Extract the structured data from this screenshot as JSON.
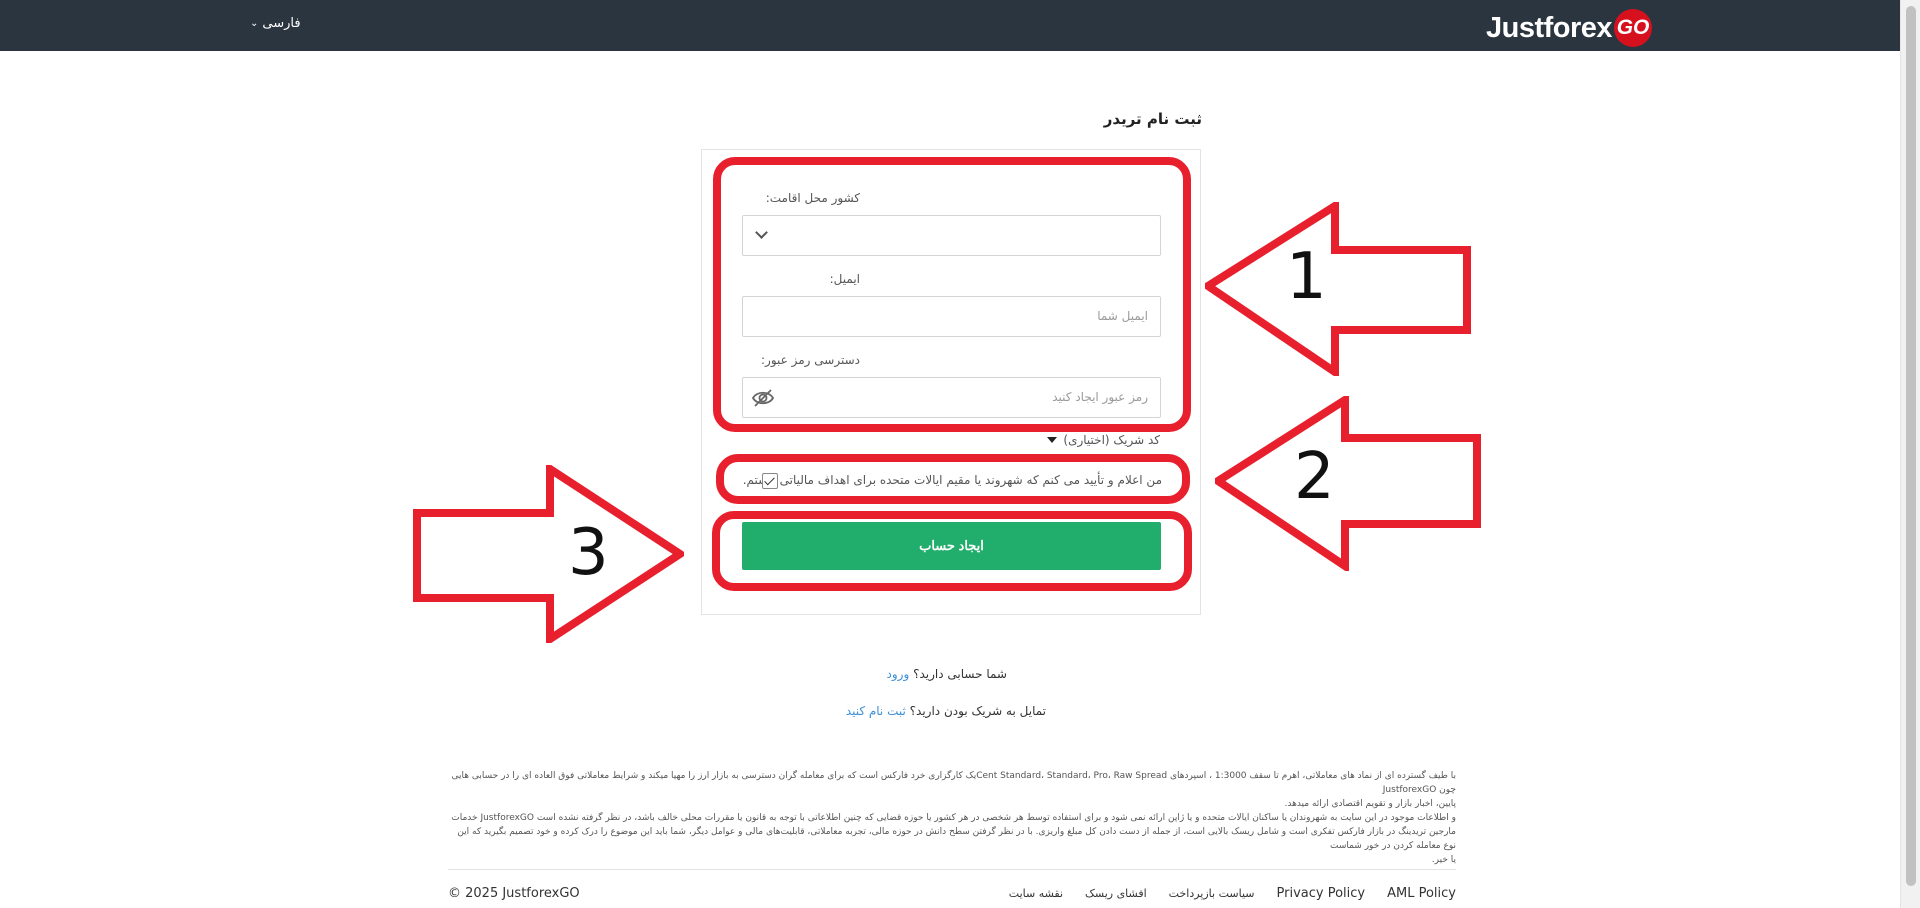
{
  "header": {
    "language": "فارسی",
    "logo_text": "Justforex",
    "logo_badge": "GO",
    "brand_color": "#2b3540",
    "logo_red": "#d7101e"
  },
  "page_title": "ثبت نام تریدر",
  "form": {
    "country_label": "کشور محل اقامت:",
    "country_value": "",
    "email_label": "ایمیل:",
    "email_placeholder": "ایمیل شما",
    "password_label": "دسترسی رمز عبور:",
    "password_placeholder": "رمز عبور ایجاد کنید",
    "partner_code_label": "کد شریک (اختیاری)",
    "declaration": "من اعلام و تأیید می کنم که شهروند یا مقیم ایالات متحده برای اهداف مالیاتی نیستم.",
    "declaration_checked": true,
    "submit_label": "ایجاد حساب",
    "submit_color": "#21ad6b"
  },
  "annotations": {
    "color": "#e8202e",
    "labels": [
      "1",
      "2",
      "3"
    ]
  },
  "links": {
    "have_account": "شما حسابی دارید؟",
    "login": "ورود",
    "partner_question": "تمایل به شریک بودن دارید؟",
    "partner_signup": "ثبت نام کنید"
  },
  "disclaimer": {
    "paragraph1_line1": "با طیف گسترده ای از نماد های معاملاتی، اهرم تا سقف 1:3000 ، اسپردهای Cent Standard، Standard، Pro، Raw Spreadیک کارگزاری خرد فارکس است که برای معامله گران دسترسی به بازار ارز را مهیا میکند و شرایط معاملاتی فوق العاده ای را در حسابی هایی چون JustforexGO",
    "paragraph1_line2": "پایین، اخبار بازار و تقویم اقتصادی ارائه میدهد.",
    "paragraph2_line1": "و اطلاعات موجود در این سایت به شهروندان یا ساکنان ایالات متحده و یا ژاپن ارائه نمی شود و برای استفاده توسط هر شخصی در هر کشور یا حوزه قضایی که چنین اطلاعاتی با توجه به قانون یا مقررات محلی خالف باشد، در نظر گرفته نشده است JustforexGO خدمات",
    "paragraph2_line2": "مارجین تریدینگ در بازار فارکس تفکری است و شامل ریسک بالایی است، از جمله از دست دادن کل مبلغ واریزی. با در نظر گرفتن سطح دانش در حوزه مالی، تجربه معاملاتی، قابلیت‌های مالی و عوامل دیگر، شما باید این موضوع را درک کرده و خود تصمیم بگیرید که این نوع معامله کردن در خور شماست",
    "paragraph2_line3": "یا خیر."
  },
  "footer": {
    "aml_policy": "AML Policy",
    "privacy_policy": "Privacy Policy",
    "refund_policy": "سیاست بازپرداخت",
    "risk_disclosure": "افشای ریسک",
    "sitemap": "نقشه سایت",
    "copyright": "© 2025 JustforexGO"
  }
}
